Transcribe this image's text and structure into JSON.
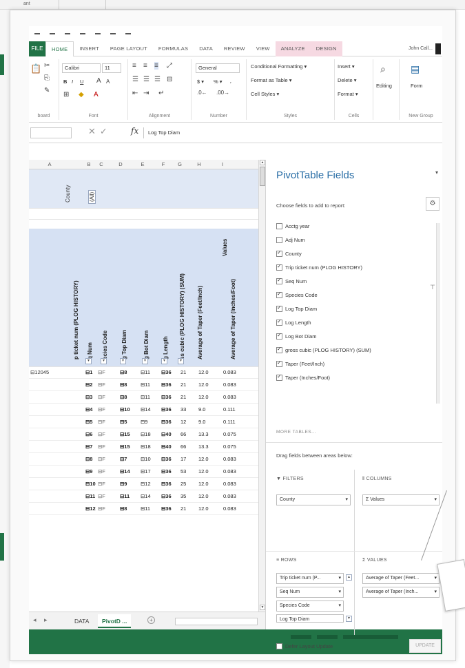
{
  "outer": {
    "tab1": "ant",
    "tab2": ""
  },
  "ribbon_tabs": {
    "file": "FILE",
    "home": "HOME",
    "insert": "INSERT",
    "page_layout": "PAGE LAYOUT",
    "formulas": "FORMULAS",
    "data": "DATA",
    "review": "REVIEW",
    "view": "VIEW",
    "analyze": "ANALYZE",
    "design": "DESIGN",
    "user": "John Call..."
  },
  "ribbon": {
    "font_name": "Calibri",
    "font_size": "11",
    "number_format": "General",
    "bold": "B",
    "italic": "I",
    "underline": "U",
    "conditional_formatting": "Conditional Formatting ▾",
    "format_as_table": "Format as Table ▾",
    "cell_styles": "Cell Styles ▾",
    "insert": "Insert ▾",
    "delete": "Delete ▾",
    "format": "Format ▾",
    "editing": "Editing",
    "form": "Form",
    "groups": {
      "clipboard": "board",
      "font": "Font",
      "alignment": "Alignment",
      "number": "Number",
      "styles": "Styles",
      "cells": "Cells",
      "new_group": "New Group"
    },
    "percent": "% ▾",
    "comma": "⸴",
    "dollar": "$ ▾"
  },
  "formula_bar": {
    "name_box": "",
    "formula": "Log Top Diam"
  },
  "columns": [
    "A",
    "B",
    "C",
    "D",
    "E",
    "F",
    "G",
    "H",
    "I"
  ],
  "pivot_top": {
    "county": "County",
    "filter_value": "(All)"
  },
  "pivot_headers": {
    "ticket": "p ticket num (PLOG HISTORY)",
    "seq": "q Num",
    "species": "ecies Code",
    "top": "g Top Diam",
    "bot": "g Bot Diam",
    "len": "g Length",
    "gross": "ss cubic (PLOG HISTORY) (SUM)",
    "avg_tf": "Average of Taper (Feet/Inch)",
    "avg_ti": "Average of Taper (Inches/Foot)",
    "values": "Values"
  },
  "rows": [
    {
      "ticket": "⊟12045",
      "seq": "⊟1",
      "sp": "⊟F",
      "top": "⊟8",
      "bot": "⊟11",
      "len": "⊟36",
      "gc": "21",
      "tf": "12.0",
      "ti": "0.083"
    },
    {
      "ticket": "",
      "seq": "⊟2",
      "sp": "⊟F",
      "top": "⊟8",
      "bot": "⊟11",
      "len": "⊟36",
      "gc": "21",
      "tf": "12.0",
      "ti": "0.083"
    },
    {
      "ticket": "",
      "seq": "⊟3",
      "sp": "⊟F",
      "top": "⊟8",
      "bot": "⊟11",
      "len": "⊟36",
      "gc": "21",
      "tf": "12.0",
      "ti": "0.083"
    },
    {
      "ticket": "",
      "seq": "⊟4",
      "sp": "⊟F",
      "top": "⊟10",
      "bot": "⊟14",
      "len": "⊟36",
      "gc": "33",
      "tf": "9.0",
      "ti": "0.111"
    },
    {
      "ticket": "",
      "seq": "⊟5",
      "sp": "⊟F",
      "top": "⊟5",
      "bot": "⊟9",
      "len": "⊟36",
      "gc": "12",
      "tf": "9.0",
      "ti": "0.111"
    },
    {
      "ticket": "",
      "seq": "⊟6",
      "sp": "⊟F",
      "top": "⊟15",
      "bot": "⊟18",
      "len": "⊟40",
      "gc": "66",
      "tf": "13.3",
      "ti": "0.075"
    },
    {
      "ticket": "",
      "seq": "⊟7",
      "sp": "⊟F",
      "top": "⊟15",
      "bot": "⊟18",
      "len": "⊟40",
      "gc": "66",
      "tf": "13.3",
      "ti": "0.075"
    },
    {
      "ticket": "",
      "seq": "⊟8",
      "sp": "⊟F",
      "top": "⊟7",
      "bot": "⊟10",
      "len": "⊟36",
      "gc": "17",
      "tf": "12.0",
      "ti": "0.083"
    },
    {
      "ticket": "",
      "seq": "⊟9",
      "sp": "⊟F",
      "top": "⊟14",
      "bot": "⊟17",
      "len": "⊟36",
      "gc": "53",
      "tf": "12.0",
      "ti": "0.083"
    },
    {
      "ticket": "",
      "seq": "⊟10",
      "sp": "⊟F",
      "top": "⊟9",
      "bot": "⊟12",
      "len": "⊟36",
      "gc": "25",
      "tf": "12.0",
      "ti": "0.083"
    },
    {
      "ticket": "",
      "seq": "⊟11",
      "sp": "⊟F",
      "top": "⊟11",
      "bot": "⊟14",
      "len": "⊟36",
      "gc": "35",
      "tf": "12.0",
      "ti": "0.083"
    },
    {
      "ticket": "",
      "seq": "⊟12",
      "sp": "⊟F",
      "top": "⊟8",
      "bot": "⊟11",
      "len": "⊟36",
      "gc": "21",
      "tf": "12.0",
      "ti": "0.083"
    }
  ],
  "sheet_tabs": {
    "data": "DATA",
    "pivot": "PivotD ...",
    "add": "⊕"
  },
  "pane": {
    "title": "PivotTable Fields",
    "choose": "Choose fields to add to report:",
    "fields": [
      {
        "label": "Acctg year",
        "checked": false
      },
      {
        "label": "Adj Num",
        "checked": false
      },
      {
        "label": "County",
        "checked": true
      },
      {
        "label": "Trip ticket num (PLOG HISTORY)",
        "checked": true
      },
      {
        "label": "Seq Num",
        "checked": true
      },
      {
        "label": "Species Code",
        "checked": true
      },
      {
        "label": "Log Top Diam",
        "checked": true
      },
      {
        "label": "Log Length",
        "checked": true
      },
      {
        "label": "Log Bot Diam",
        "checked": true
      },
      {
        "label": "gross cubic (PLOG HISTORY) (SUM)",
        "checked": true
      },
      {
        "label": "Taper (Feet/Inch)",
        "checked": true
      },
      {
        "label": "Taper (Inches/Foot)",
        "checked": true
      }
    ],
    "more_tables": "MORE TABLES...",
    "drag": "Drag fields between areas below:",
    "filters_label": "FILTERS",
    "columns_label": "COLUMNS",
    "rows_label": "ROWS",
    "values_label": "VALUES",
    "filters": [
      "County"
    ],
    "columns": [
      "Σ Values"
    ],
    "rows": [
      "Trip ticket num (P...",
      "Seq Num",
      "Species Code",
      "Log Top Diam"
    ],
    "values": [
      "Average of Taper (Feet...",
      "Average of Taper (Inch..."
    ],
    "defer": "Defer Layout Update",
    "update": "UPDATE"
  }
}
